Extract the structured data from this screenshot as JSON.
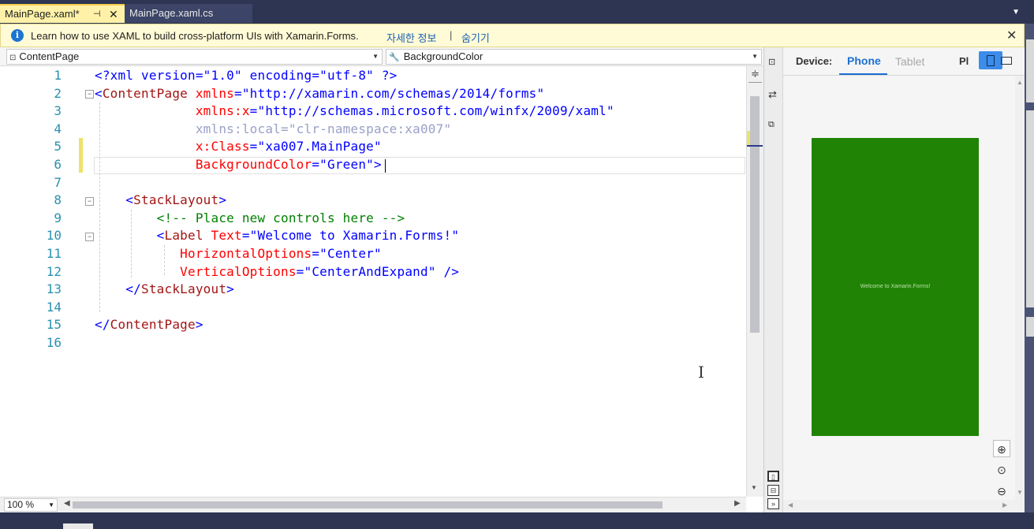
{
  "tabs": [
    {
      "label": "MainPage.xaml*",
      "active": true,
      "pin_icon": "pin-icon",
      "close_label": "✕"
    },
    {
      "label": "MainPage.xaml.cs",
      "active": false
    }
  ],
  "infobar": {
    "icon": "info-icon",
    "message": "Learn how to use XAML to build cross-platform UIs with Xamarin.Forms.",
    "link_more": "자세한 정보",
    "separator": "|",
    "link_hide": "숨기기",
    "close_label": "✕"
  },
  "navbar": {
    "left_combo": "ContentPage",
    "right_combo": "BackgroundColor"
  },
  "editor": {
    "line_numbers": [
      "1",
      "2",
      "3",
      "4",
      "5",
      "6",
      "7",
      "8",
      "9",
      "10",
      "11",
      "12",
      "13",
      "14",
      "15",
      "16"
    ],
    "lines": [
      [
        {
          "t": "<?xml version=\"1.0\" encoding=\"utf-8\" ?>",
          "c": "bl"
        }
      ],
      [
        {
          "t": "<",
          "c": "bl"
        },
        {
          "t": "ContentPage",
          "c": "br"
        },
        {
          "t": " xmlns",
          "c": "rd"
        },
        {
          "t": "=\"http://xamarin.com/schemas/2014/forms\"",
          "c": "bl"
        }
      ],
      [
        {
          "t": "             xmlns:x",
          "c": "rd"
        },
        {
          "t": "=\"http://schemas.microsoft.com/winfx/2009/xaml\"",
          "c": "bl"
        }
      ],
      [
        {
          "t": "             xmlns:local=\"clr-namespace:xa007\"",
          "c": "dim"
        }
      ],
      [
        {
          "t": "             x:Class",
          "c": "rd"
        },
        {
          "t": "=\"xa007.MainPage\"",
          "c": "bl"
        }
      ],
      [
        {
          "t": "             BackgroundColor",
          "c": "rd"
        },
        {
          "t": "=\"Green\"",
          "c": "bl"
        },
        {
          "t": ">",
          "c": "bl"
        }
      ],
      [],
      [
        {
          "t": "    <",
          "c": "bl"
        },
        {
          "t": "StackLayout",
          "c": "br"
        },
        {
          "t": ">",
          "c": "bl"
        }
      ],
      [
        {
          "t": "        <!-- Place new controls here -->",
          "c": "gr"
        }
      ],
      [
        {
          "t": "        <",
          "c": "bl"
        },
        {
          "t": "Label",
          "c": "br"
        },
        {
          "t": " Text",
          "c": "rd"
        },
        {
          "t": "=\"Welcome to Xamarin.Forms!\"",
          "c": "bl"
        }
      ],
      [
        {
          "t": "           HorizontalOptions",
          "c": "rd"
        },
        {
          "t": "=\"Center\"",
          "c": "bl"
        }
      ],
      [
        {
          "t": "           VerticalOptions",
          "c": "rd"
        },
        {
          "t": "=\"CenterAndExpand\" />",
          "c": "bl"
        }
      ],
      [
        {
          "t": "    </",
          "c": "bl"
        },
        {
          "t": "StackLayout",
          "c": "br"
        },
        {
          "t": ">",
          "c": "bl"
        }
      ],
      [],
      [
        {
          "t": "</",
          "c": "bl"
        },
        {
          "t": "ContentPage",
          "c": "br"
        },
        {
          "t": ">",
          "c": "bl"
        }
      ],
      []
    ],
    "zoom": "100 %"
  },
  "preview": {
    "device_label": "Device:",
    "tab_phone": "Phone",
    "tab_tablet": "Tablet",
    "platform_label": "Pl",
    "screen_color": "#218306",
    "screen_text": "Welcome to Xamarin.Forms!",
    "zoom_in_icon": "zoom-in-icon",
    "zoom_fit_icon": "zoom-fit-icon",
    "zoom_out_icon": "zoom-out-icon"
  },
  "colors": {
    "tab_active_bg": "#fff2a8",
    "chrome_dark": "#2d3553",
    "accent": "#1c6fd1"
  }
}
